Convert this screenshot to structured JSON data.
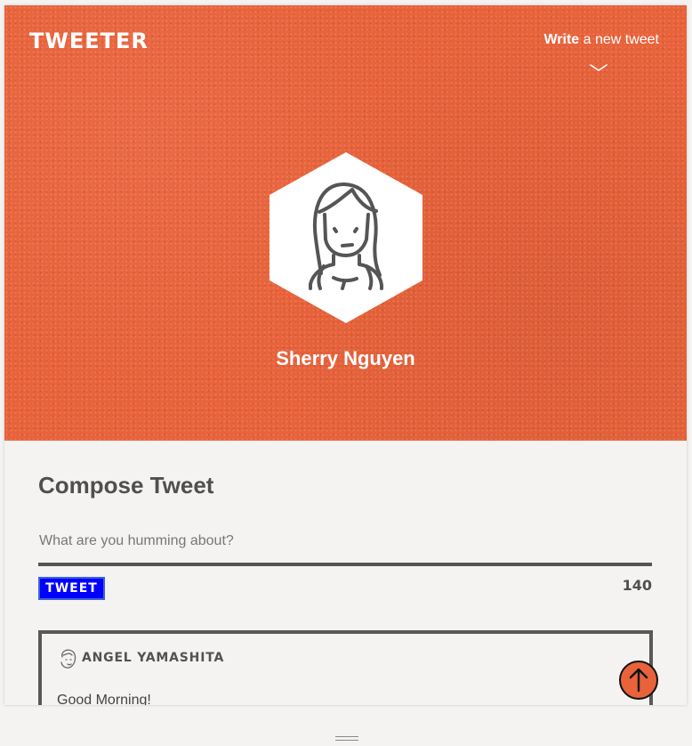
{
  "app": {
    "logo": "TWEETER"
  },
  "header": {
    "write_link_bold": "Write",
    "write_link_rest": " a new tweet"
  },
  "profile": {
    "name": "Sherry Nguyen"
  },
  "compose": {
    "title": "Compose Tweet",
    "placeholder": "What are you humming about?",
    "value": "",
    "button_label": "TWEET",
    "char_count": "140"
  },
  "tweets": [
    {
      "author": "ANGEL YAMASHITA",
      "text": "Good Morning!"
    }
  ],
  "icons": {
    "chevron": "chevron-down-icon",
    "avatar": "woman-avatar-icon",
    "author": "profile-avatar-icon",
    "flag": "flag-icon",
    "heart": "heart-icon",
    "scroll_top": "arrow-up-icon"
  },
  "colors": {
    "hero_background": "#e8623a",
    "button_background": "#0000ff",
    "scroll_button": "#e8623a",
    "text_dark": "#4f4f4f"
  }
}
